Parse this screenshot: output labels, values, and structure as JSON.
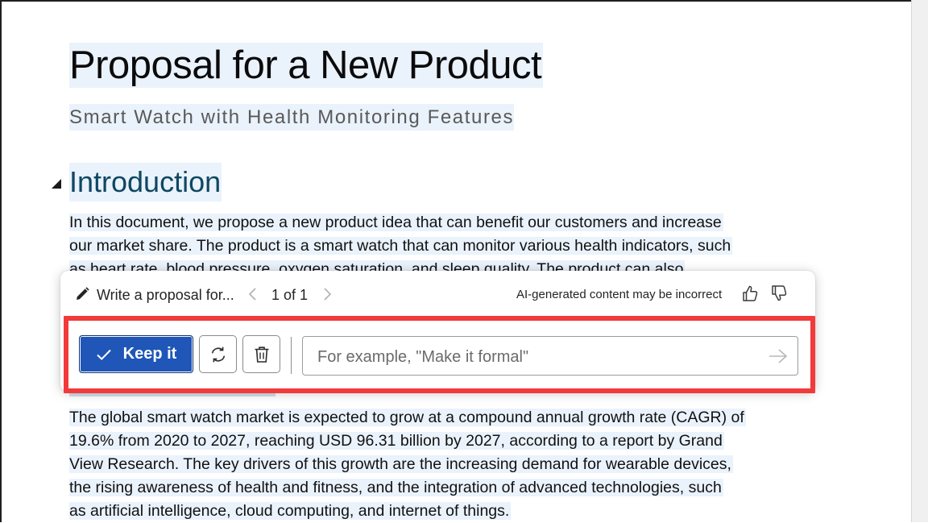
{
  "document": {
    "title": "Proposal for a New Product",
    "subtitle": "Smart Watch with Health Monitoring Features",
    "heading_introduction": "Introduction",
    "intro_lines": [
      "In this document, we propose a new product idea that can benefit our customers and increase",
      "our market share. The product is a smart watch that can monitor various health indicators, such",
      "as heart rate, blood pressure, oxygen saturation, and sleep quality. The product can also"
    ],
    "market_lines": [
      "The global smart watch market is expected to grow at a compound annual growth rate (CAGR) of",
      "19.6% from 2020 to 2027, reaching USD 96.31 billion by 2027, according to a report by Grand",
      "View Research. The key drivers of this growth are the increasing demand for wearable devices,",
      "the rising awareness of health and fitness, and the integration of advanced technologies, such",
      "as artificial intelligence, cloud computing, and internet of things."
    ]
  },
  "copilot": {
    "prompt_label": "Write a proposal for...",
    "page_indicator": "1 of 1",
    "ai_notice": "AI-generated content may be incorrect",
    "keep_label": "Keep it",
    "input_placeholder": "For example, \"Make it formal\"",
    "icons": {
      "edit": "pencil-icon",
      "previous": "chevron-left-icon",
      "next": "chevron-right-icon",
      "like": "thumbs-up-icon",
      "dislike": "thumbs-down-icon",
      "keep": "checkmark-icon",
      "regenerate": "refresh-icon",
      "discard": "trash-icon",
      "send": "arrow-right-icon"
    }
  },
  "colors": {
    "selection_highlight": "#eaf2fc",
    "heading_color": "#0f4761",
    "keep_button": "#1f56b8",
    "annotation_frame": "#f23a3a"
  }
}
